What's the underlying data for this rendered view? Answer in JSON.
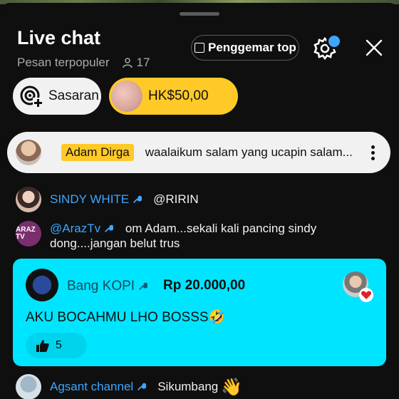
{
  "header": {
    "title": "Live chat",
    "subtitle": "Pesan terpopuler",
    "viewer_count": "17",
    "fan_button_label": "Penggemar top",
    "accent": "#3ea6ff"
  },
  "chips": {
    "target_label": "Sasaran",
    "super_amount": "HK$50,00",
    "super_color": "#ffca28"
  },
  "pinned": {
    "author": "Adam Dirga",
    "message": "waalaikum salam yang ucapin salam..."
  },
  "messages": [
    {
      "author": "SINDY WHITE",
      "text": "@RIRIN"
    },
    {
      "author": "@ArazTv",
      "avatar_text": "ARAZ TV",
      "text": "om Adam...sekali kali pancing sindy dong....jangan belut trus"
    },
    {
      "author": "Agsant channel",
      "text": "Sikumbang"
    }
  ],
  "super_chat": {
    "author": "Bang KOPI",
    "amount": "Rp 20.000,00",
    "message": "AKU BOCAHMU LHO BOSSS🤣",
    "likes": "5",
    "color": "#00e5ff"
  }
}
